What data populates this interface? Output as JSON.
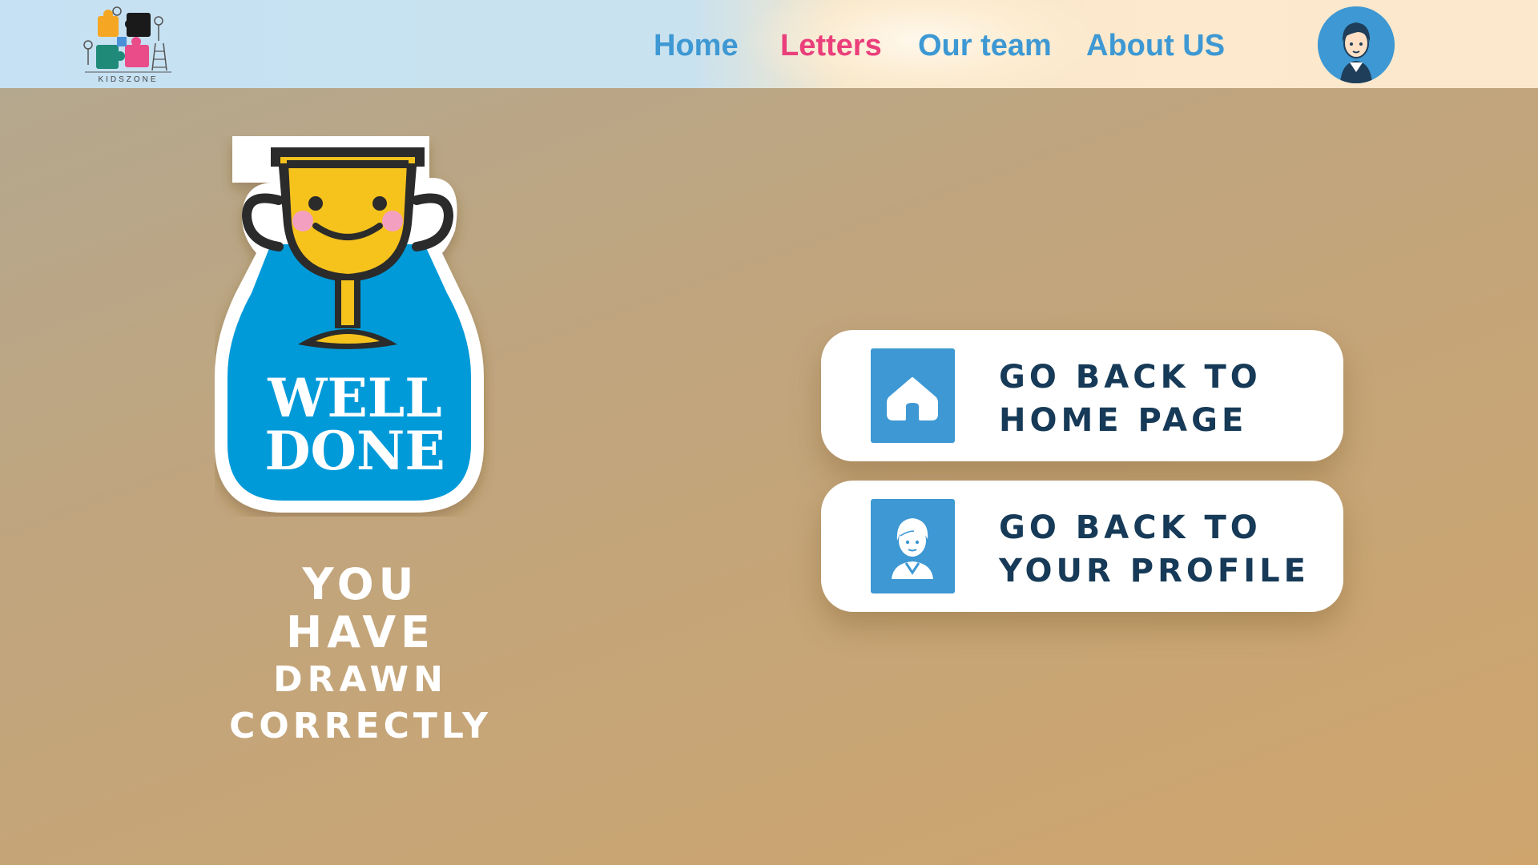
{
  "header": {
    "logo_text": "KIDSZONE",
    "nav": [
      {
        "label": "Home",
        "active": false
      },
      {
        "label": "Letters",
        "active": true
      },
      {
        "label": "Our team",
        "active": false
      },
      {
        "label": "About US",
        "active": false
      }
    ],
    "avatar_icon": "user-avatar-icon"
  },
  "badge": {
    "line1": "WELL",
    "line2": "DONE"
  },
  "message": {
    "line1": "YOU",
    "line2": "HAVE",
    "line3": "DRAWN",
    "line4": "CORRECTLY"
  },
  "actions": {
    "home": {
      "line1": "GO BACK TO",
      "line2": "HOME PAGE",
      "icon": "home-icon"
    },
    "profile": {
      "line1": "GO BACK TO",
      "line2": "YOUR PROFILE",
      "icon": "profile-icon"
    }
  },
  "colors": {
    "primary_blue": "#3d98d3",
    "active_pink": "#ea3f7b",
    "button_text": "#163a57",
    "trophy_yellow": "#f6c21c"
  }
}
